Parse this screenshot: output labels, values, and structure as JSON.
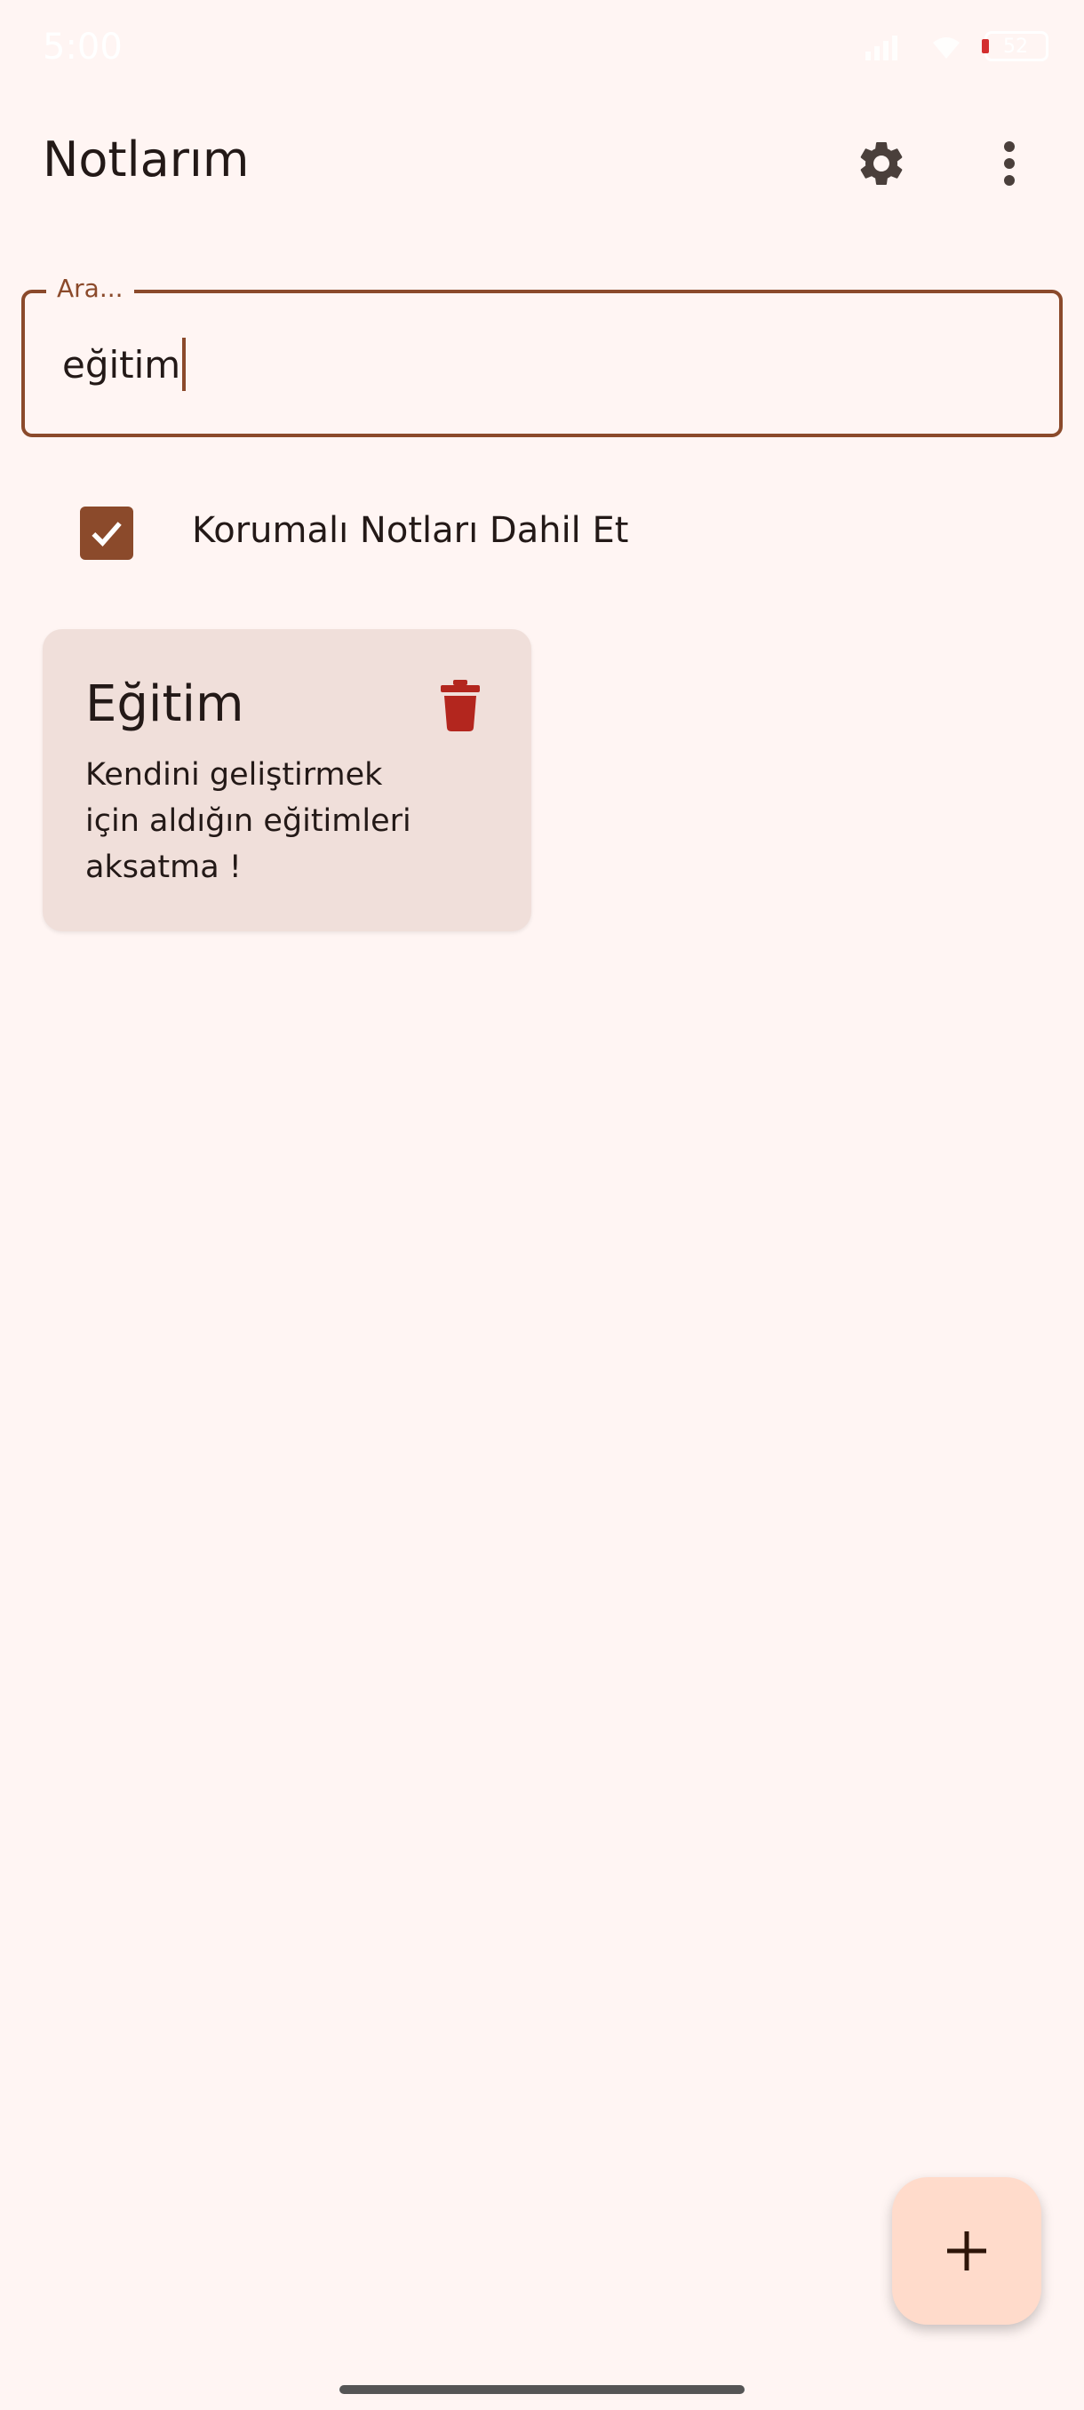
{
  "status_bar": {
    "time": "5:00",
    "battery": "52"
  },
  "app_bar": {
    "title": "Notlarım"
  },
  "search": {
    "label": "Ara...",
    "value": "eğitim"
  },
  "filter": {
    "label": "Korumalı Notları Dahil Et",
    "checked": true
  },
  "notes": [
    {
      "title": "Eğitim",
      "body": "Kendini geliştirmek için aldığın eğitimleri aksatma !"
    }
  ],
  "colors": {
    "background": "#FFF5F3",
    "accent": "#8B4A2B",
    "card": "#F0DFDA",
    "delete": "#B3261E",
    "fab": "#FFDBCB"
  },
  "icons": [
    "gear-icon",
    "more-vert-icon",
    "check-icon",
    "trash-icon",
    "plus-icon"
  ]
}
